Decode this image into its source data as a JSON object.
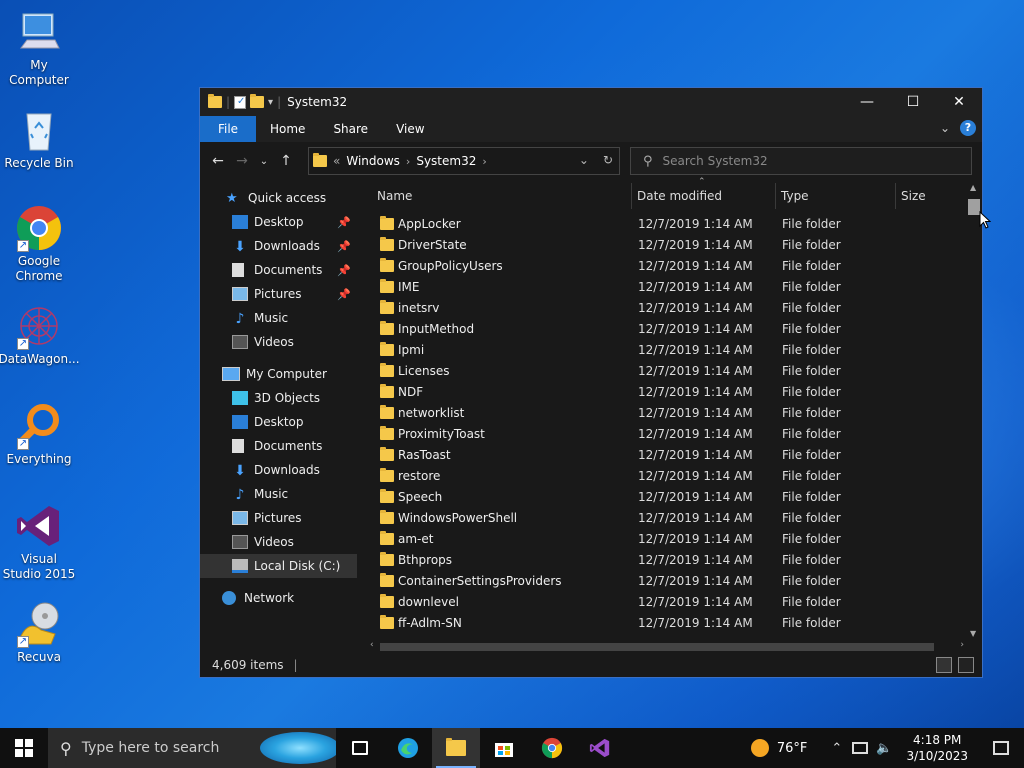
{
  "desktop": {
    "icons": [
      {
        "label": "My Computer"
      },
      {
        "label": "Recycle Bin"
      },
      {
        "label": "Google Chrome"
      },
      {
        "label": "DataWagon..."
      },
      {
        "label": "Everything"
      },
      {
        "label": "Visual Studio 2015"
      },
      {
        "label": "Recuva"
      }
    ]
  },
  "window": {
    "title": "System32",
    "controls": {
      "minimize": "—",
      "maximize": "☐",
      "close": "✕"
    },
    "ribbon_tabs": [
      "File",
      "Home",
      "Share",
      "View"
    ],
    "help": "?",
    "address": {
      "overflow": "«",
      "segments": [
        "Windows",
        "System32"
      ]
    },
    "search_placeholder": "Search System32",
    "nav": {
      "quick_access": "Quick access",
      "quick_items": [
        "Desktop",
        "Downloads",
        "Documents",
        "Pictures",
        "Music",
        "Videos"
      ],
      "my_computer": "My Computer",
      "pc_items": [
        "3D Objects",
        "Desktop",
        "Documents",
        "Downloads",
        "Music",
        "Pictures",
        "Videos",
        "Local Disk (C:)"
      ],
      "network": "Network"
    },
    "columns": {
      "name": "Name",
      "date": "Date modified",
      "type": "Type",
      "size": "Size"
    },
    "rows": [
      {
        "name": "AppLocker",
        "date": "12/7/2019 1:14 AM",
        "type": "File folder"
      },
      {
        "name": "DriverState",
        "date": "12/7/2019 1:14 AM",
        "type": "File folder"
      },
      {
        "name": "GroupPolicyUsers",
        "date": "12/7/2019 1:14 AM",
        "type": "File folder"
      },
      {
        "name": "IME",
        "date": "12/7/2019 1:14 AM",
        "type": "File folder"
      },
      {
        "name": "inetsrv",
        "date": "12/7/2019 1:14 AM",
        "type": "File folder"
      },
      {
        "name": "InputMethod",
        "date": "12/7/2019 1:14 AM",
        "type": "File folder"
      },
      {
        "name": "Ipmi",
        "date": "12/7/2019 1:14 AM",
        "type": "File folder"
      },
      {
        "name": "Licenses",
        "date": "12/7/2019 1:14 AM",
        "type": "File folder"
      },
      {
        "name": "NDF",
        "date": "12/7/2019 1:14 AM",
        "type": "File folder"
      },
      {
        "name": "networklist",
        "date": "12/7/2019 1:14 AM",
        "type": "File folder"
      },
      {
        "name": "ProximityToast",
        "date": "12/7/2019 1:14 AM",
        "type": "File folder"
      },
      {
        "name": "RasToast",
        "date": "12/7/2019 1:14 AM",
        "type": "File folder"
      },
      {
        "name": "restore",
        "date": "12/7/2019 1:14 AM",
        "type": "File folder"
      },
      {
        "name": "Speech",
        "date": "12/7/2019 1:14 AM",
        "type": "File folder"
      },
      {
        "name": "WindowsPowerShell",
        "date": "12/7/2019 1:14 AM",
        "type": "File folder"
      },
      {
        "name": "am-et",
        "date": "12/7/2019 1:14 AM",
        "type": "File folder"
      },
      {
        "name": "Bthprops",
        "date": "12/7/2019 1:14 AM",
        "type": "File folder"
      },
      {
        "name": "ContainerSettingsProviders",
        "date": "12/7/2019 1:14 AM",
        "type": "File folder"
      },
      {
        "name": "downlevel",
        "date": "12/7/2019 1:14 AM",
        "type": "File folder"
      },
      {
        "name": "ff-Adlm-SN",
        "date": "12/7/2019 1:14 AM",
        "type": "File folder"
      }
    ],
    "status": "4,609 items"
  },
  "taskbar": {
    "search_placeholder": "Type here to search",
    "weather": "76°F",
    "time": "4:18 PM",
    "date": "3/10/2023"
  },
  "colors": {
    "accent": "#1a6dc9",
    "folder": "#f5c84a",
    "window_bg": "#191919"
  }
}
